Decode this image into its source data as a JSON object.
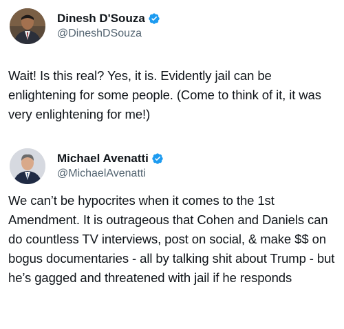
{
  "tweets": [
    {
      "author": {
        "display_name": "Dinesh D'Souza",
        "handle": "@DineshDSouza",
        "verified": true,
        "avatar": "avatar-photo"
      },
      "text": "Wait! Is this real? Yes, it is. Evidently jail can be enlightening for some people. (Come to think of it, it was very enlightening for me!)"
    },
    {
      "author": {
        "display_name": "Michael Avenatti",
        "handle": "@MichaelAvenatti",
        "verified": true,
        "avatar": "avatar-photo"
      },
      "text": "We can’t be hypocrites when it comes to the 1st Amendment. It is outrageous that Cohen and Daniels can do countless TV interviews, post on social, & make $$ on bogus documentaries - all by talking shit about Trump - but he’s gagged and threatened with jail if he responds"
    }
  ],
  "colors": {
    "verified_badge": "#1d9bf0",
    "handle_text": "#536471",
    "body_text": "#0f1419"
  },
  "icons": {
    "verified": "verified-badge-icon"
  }
}
